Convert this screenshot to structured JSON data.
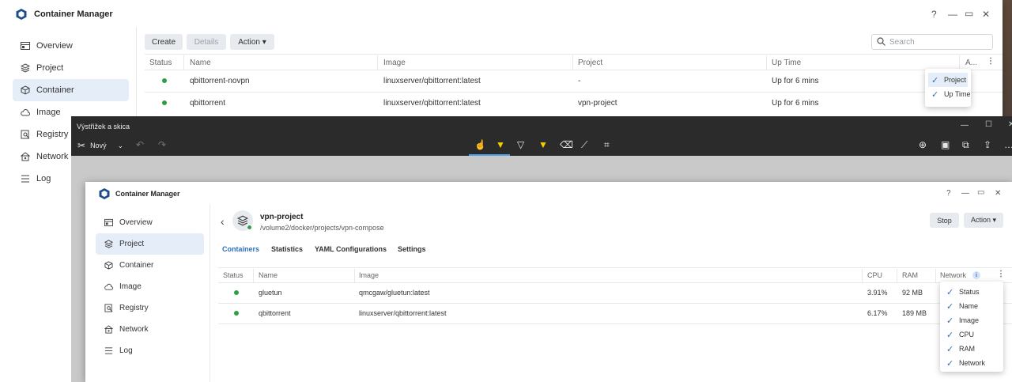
{
  "bg_window": {
    "title": "Container Manager",
    "controls": [
      "?",
      "—",
      "▭",
      "✕"
    ],
    "sidebar": [
      {
        "label": "Overview",
        "icon": "overview-icon"
      },
      {
        "label": "Project",
        "icon": "project-icon"
      },
      {
        "label": "Container",
        "icon": "container-icon"
      },
      {
        "label": "Image",
        "icon": "image-icon"
      },
      {
        "label": "Registry",
        "icon": "registry-icon"
      },
      {
        "label": "Network",
        "icon": "network-icon"
      },
      {
        "label": "Log",
        "icon": "log-icon"
      }
    ],
    "toolbar": {
      "create": "Create",
      "details": "Details",
      "action": "Action ▾"
    },
    "search_placeholder": "Search",
    "columns": [
      "Status",
      "Name",
      "Image",
      "Project",
      "Up Time",
      "A..."
    ],
    "rows": [
      {
        "name": "qbittorrent-novpn",
        "image": "linuxserver/qbittorrent:latest",
        "project": "-",
        "uptime": "Up for 6 mins"
      },
      {
        "name": "qbittorrent",
        "image": "linuxserver/qbittorrent:latest",
        "project": "vpn-project",
        "uptime": "Up for 6 mins"
      }
    ],
    "column_menu": [
      "Project",
      "Up Time"
    ]
  },
  "snip_window": {
    "title": "Výstřižek a skica",
    "new_label": "Nový",
    "controls": [
      "—",
      "☐",
      "✕"
    ]
  },
  "fg_window": {
    "title": "Container Manager",
    "controls": [
      "?",
      "—",
      "▭",
      "✕"
    ],
    "sidebar": [
      {
        "label": "Overview"
      },
      {
        "label": "Project"
      },
      {
        "label": "Container"
      },
      {
        "label": "Image"
      },
      {
        "label": "Registry"
      },
      {
        "label": "Network"
      },
      {
        "label": "Log"
      }
    ],
    "project": {
      "name": "vpn-project",
      "path": "/volume2/docker/projects/vpn-compose"
    },
    "actions": {
      "stop": "Stop",
      "action": "Action ▾"
    },
    "tabs": [
      "Containers",
      "Statistics",
      "YAML Configurations",
      "Settings"
    ],
    "columns": [
      "Status",
      "Name",
      "Image",
      "CPU",
      "RAM",
      "Network"
    ],
    "rows": [
      {
        "name": "gluetun",
        "image": "qmcgaw/gluetun:latest",
        "cpu": "3.91%",
        "ram": "92 MB"
      },
      {
        "name": "qbittorrent",
        "image": "linuxserver/qbittorrent:latest",
        "cpu": "6.17%",
        "ram": "189 MB"
      }
    ],
    "column_menu": [
      "Status",
      "Name",
      "Image",
      "CPU",
      "RAM",
      "Network"
    ]
  },
  "colors": {
    "accent": "#2f6fbf",
    "running": "#2ea043",
    "snip_dark": "#2b2b2b"
  }
}
